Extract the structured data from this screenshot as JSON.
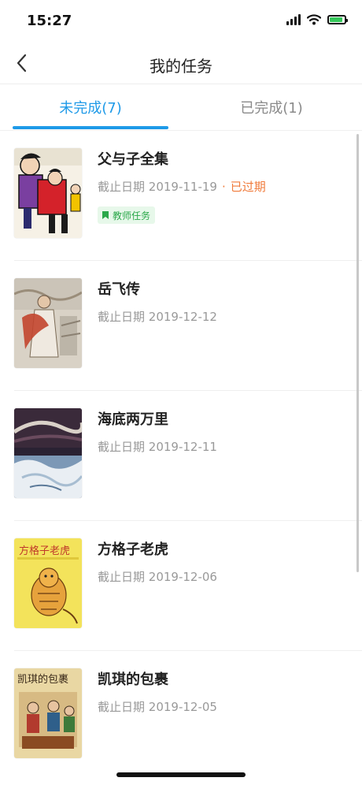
{
  "status_bar": {
    "time": "15:27"
  },
  "nav": {
    "title": "我的任务"
  },
  "tabs": [
    {
      "label": "未完成(7)",
      "active": true
    },
    {
      "label": "已完成(1)",
      "active": false
    }
  ],
  "colors": {
    "accent": "#1e9ae8",
    "overdue": "#f07a3a",
    "badge_text": "#2ba84a",
    "badge_bg": "#e7f8ea"
  },
  "tasks": [
    {
      "title": "父与子全集",
      "deadline_label": "截止日期",
      "date": "2019-11-19",
      "status": "已过期",
      "badge": "教师任务"
    },
    {
      "title": "岳飞传",
      "deadline_label": "截止日期",
      "date": "2019-12-12"
    },
    {
      "title": "海底两万里",
      "deadline_label": "截止日期",
      "date": "2019-12-11"
    },
    {
      "title": "方格子老虎",
      "deadline_label": "截止日期",
      "date": "2019-12-06",
      "cover_text": "方格子老虎"
    },
    {
      "title": "凯琪的包裹",
      "deadline_label": "截止日期",
      "date": "2019-12-05",
      "cover_text": "凯琪的包裹"
    }
  ]
}
